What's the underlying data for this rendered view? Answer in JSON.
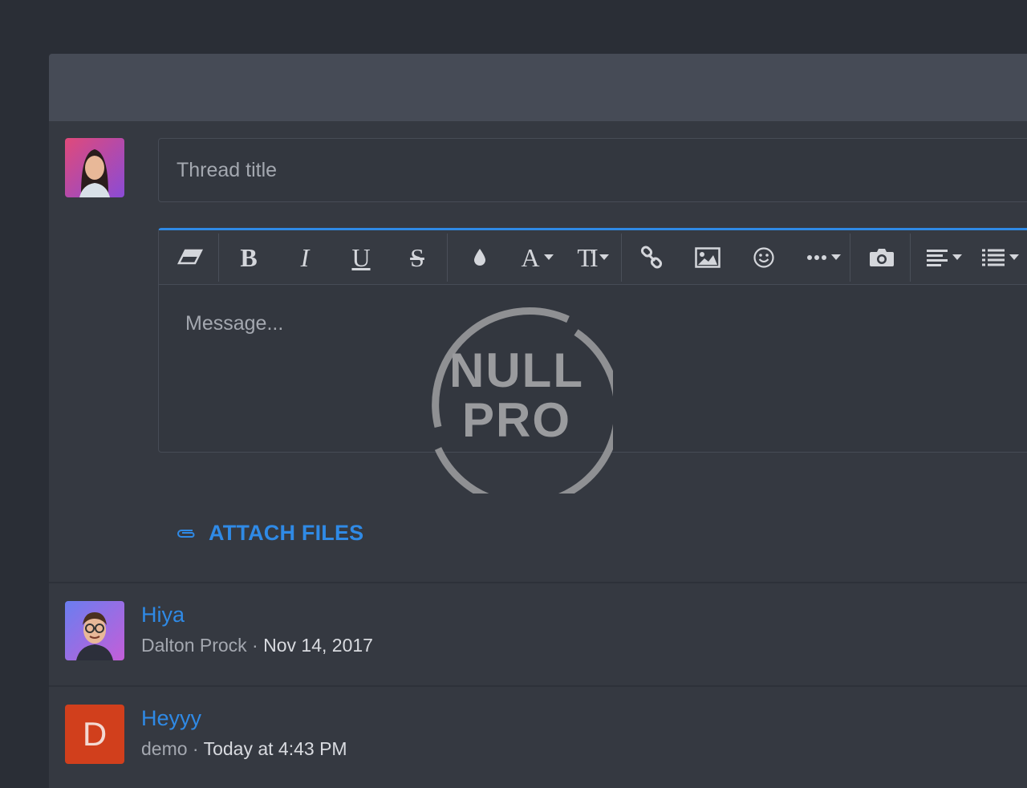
{
  "composer": {
    "title_placeholder": "Thread title",
    "message_placeholder": "Message...",
    "attach_label": "ATTACH FILES"
  },
  "toolbar": {
    "items": [
      {
        "name": "remove-format",
        "icon": "eraser-icon"
      },
      {
        "name": "bold",
        "glyph": "B"
      },
      {
        "name": "italic",
        "glyph": "I"
      },
      {
        "name": "underline",
        "glyph": "U"
      },
      {
        "name": "strikethrough",
        "glyph": "S"
      },
      {
        "name": "text-color",
        "icon": "droplet-icon"
      },
      {
        "name": "font-family",
        "glyph": "A"
      },
      {
        "name": "font-size",
        "glyph": "TI"
      },
      {
        "name": "insert-link",
        "icon": "link-icon"
      },
      {
        "name": "insert-image",
        "icon": "image-icon"
      },
      {
        "name": "insert-emoji",
        "icon": "smiley-icon"
      },
      {
        "name": "more-insert",
        "icon": "ellipsis-icon"
      },
      {
        "name": "insert-media",
        "icon": "camera-icon"
      },
      {
        "name": "align",
        "icon": "align-left-icon"
      },
      {
        "name": "list",
        "icon": "list-icon"
      }
    ]
  },
  "watermark": {
    "line1": "NULL",
    "line2": "PRO"
  },
  "threads": [
    {
      "title": "Hiya",
      "author": "Dalton Prock",
      "separator": " · ",
      "date": "Nov 14, 2017",
      "avatar": "illustrated-avatar"
    },
    {
      "title": "Heyyy",
      "author": "demo",
      "separator": " · ",
      "date": "Today at 4:43 PM",
      "avatar_letter": "D"
    }
  ],
  "colors": {
    "accent": "#2f8ae6",
    "letter_avatar_bg": "#d13f1c",
    "background": "#2a2e36",
    "panel": "#353941"
  }
}
